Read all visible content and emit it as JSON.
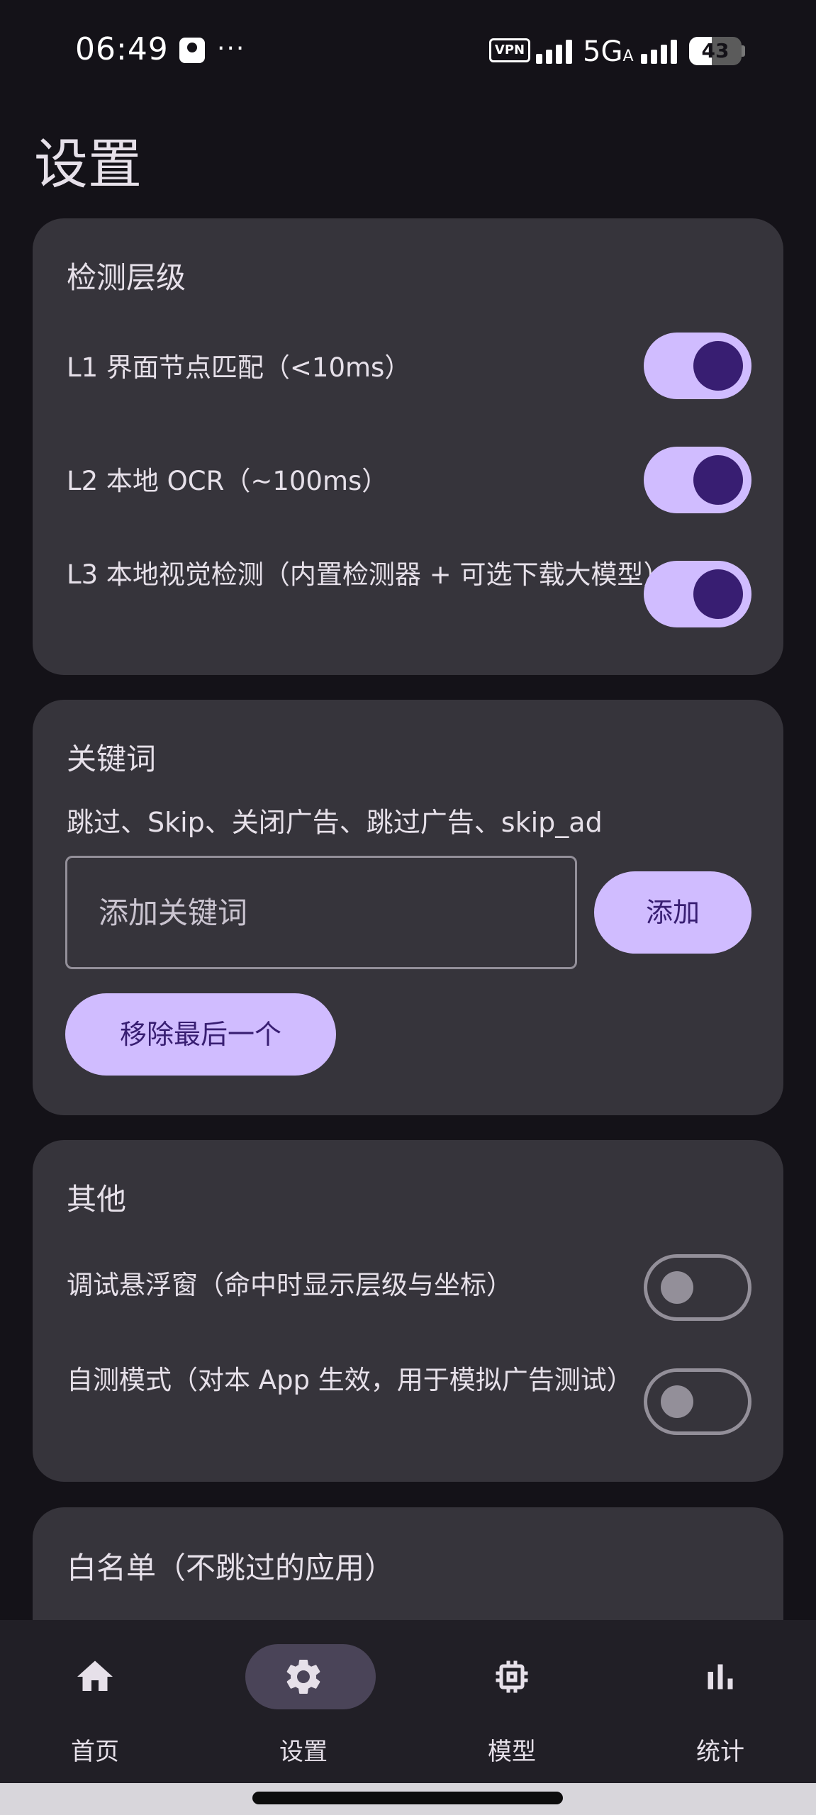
{
  "status_bar": {
    "time": "06:49",
    "dots": "···",
    "vpn": "VPN",
    "network": "5G",
    "network_sub": "A",
    "battery": "43",
    "battery_level": 0.43
  },
  "page": {
    "title": "设置"
  },
  "detection": {
    "title": "检测层级",
    "items": [
      {
        "label": "L1 界面节点匹配（<10ms）",
        "enabled": true
      },
      {
        "label": "L2 本地 OCR（~100ms）",
        "enabled": true
      },
      {
        "label": "L3 本地视觉检测（内置检测器 + 可选下载大模型）",
        "enabled": true
      }
    ]
  },
  "keywords": {
    "title": "关键词",
    "list": "跳过、Skip、关闭广告、跳过广告、skip_ad",
    "input_placeholder": "添加关键词",
    "add_label": "添加",
    "remove_last_label": "移除最后一个"
  },
  "other": {
    "title": "其他",
    "items": [
      {
        "label": "调试悬浮窗（命中时显示层级与坐标）",
        "enabled": false
      },
      {
        "label": "自测模式（对本 App 生效，用于模拟广告测试）",
        "enabled": false
      }
    ]
  },
  "whitelist": {
    "title": "白名单（不跳过的应用）"
  },
  "nav": {
    "items": [
      {
        "label": "首页",
        "icon": "home-icon",
        "active": false
      },
      {
        "label": "设置",
        "icon": "gear-icon",
        "active": true
      },
      {
        "label": "模型",
        "icon": "chip-icon",
        "active": false
      },
      {
        "label": "统计",
        "icon": "bar-chart-icon",
        "active": false
      }
    ]
  },
  "colors": {
    "background": "#141218",
    "card": "#36343B",
    "primary": "#D0BCFF",
    "on_primary": "#381E72",
    "nav_bg": "#211F26",
    "nav_indicator": "#4A4458"
  }
}
